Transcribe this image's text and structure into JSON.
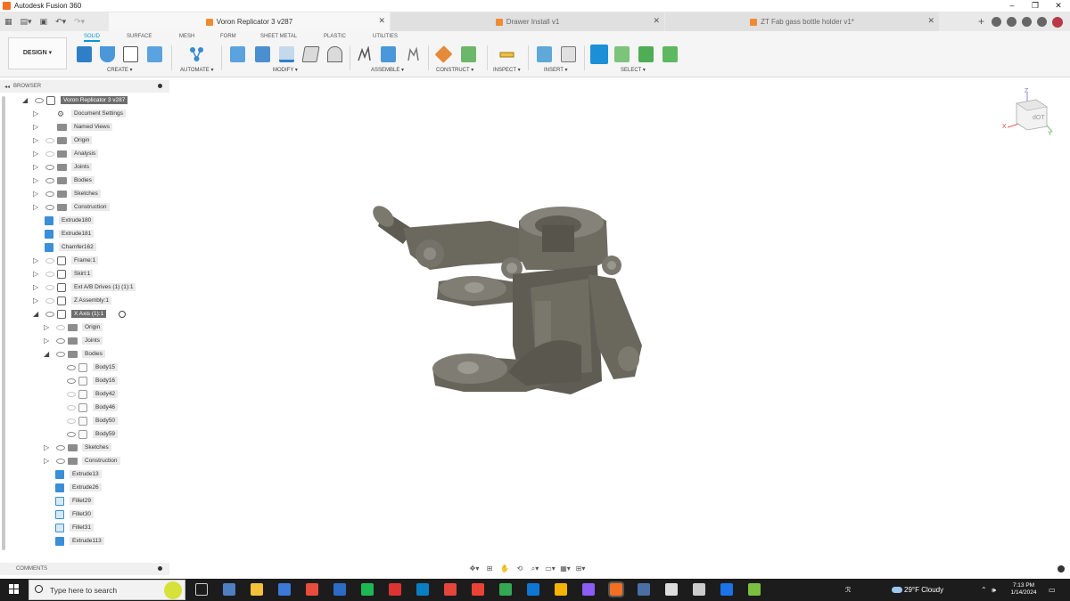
{
  "window": {
    "title": "Autodesk Fusion 360",
    "controls": [
      "–",
      "❐",
      "✕"
    ]
  },
  "tabs": [
    {
      "label": "Voron Replicator 3 v287",
      "active": true
    },
    {
      "label": "Drawer Install v1",
      "active": false
    },
    {
      "label": "ZT Fab gass bottle holder v1*",
      "active": false
    }
  ],
  "workspace": {
    "label": "DESIGN ▾"
  },
  "ribbon": {
    "tabs": [
      "SOLID",
      "SURFACE",
      "MESH",
      "FORM",
      "SHEET METAL",
      "PLASTIC",
      "UTILITIES"
    ],
    "active_tab": "SOLID",
    "groups": [
      "CREATE ▾",
      "AUTOMATE ▾",
      "MODIFY ▾",
      "ASSEMBLE ▾",
      "CONSTRUCT ▾",
      "INSPECT ▾",
      "INSERT ▾",
      "SELECT ▾"
    ]
  },
  "browser": {
    "title": "BROWSER",
    "items": [
      {
        "label": "Voron Replicator 3 v287",
        "indent": 0,
        "expanded": true,
        "icon": "component",
        "eye": true,
        "selected": true
      },
      {
        "label": "Document Settings",
        "indent": 1,
        "arrow": true,
        "icon": "gear"
      },
      {
        "label": "Named Views",
        "indent": 1,
        "arrow": true,
        "icon": "folder"
      },
      {
        "label": "Origin",
        "indent": 1,
        "arrow": true,
        "icon": "folder",
        "eye": "dim"
      },
      {
        "label": "Analysis",
        "indent": 1,
        "arrow": true,
        "icon": "folder",
        "eye": "dim"
      },
      {
        "label": "Joints",
        "indent": 1,
        "arrow": true,
        "icon": "folder",
        "eye": true
      },
      {
        "label": "Bodies",
        "indent": 1,
        "arrow": true,
        "icon": "folder",
        "eye": true
      },
      {
        "label": "Sketches",
        "indent": 1,
        "arrow": true,
        "icon": "folder",
        "eye": true
      },
      {
        "label": "Construction",
        "indent": 1,
        "arrow": true,
        "icon": "folder",
        "eye": true
      },
      {
        "label": "Extrude180",
        "indent": 1,
        "icon": "feature"
      },
      {
        "label": "Extrude181",
        "indent": 1,
        "icon": "feature"
      },
      {
        "label": "Chamfer162",
        "indent": 1,
        "icon": "feature"
      },
      {
        "label": "Frame:1",
        "indent": 1,
        "arrow": true,
        "icon": "component",
        "eye": "dim"
      },
      {
        "label": "Skirt:1",
        "indent": 1,
        "arrow": true,
        "icon": "component",
        "eye": "dim"
      },
      {
        "label": "Ext A/B Drives (1) (1):1",
        "indent": 1,
        "arrow": true,
        "icon": "component",
        "eye": "dim"
      },
      {
        "label": "Z Assembly:1",
        "indent": 1,
        "arrow": true,
        "icon": "component",
        "eye": "dim"
      },
      {
        "label": "X Axis (1):1",
        "indent": 1,
        "expanded": true,
        "icon": "component",
        "eye": true,
        "selected": true,
        "target": true
      },
      {
        "label": "Origin",
        "indent": 2,
        "arrow": true,
        "icon": "folder",
        "eye": "dim"
      },
      {
        "label": "Joints",
        "indent": 2,
        "arrow": true,
        "icon": "folder",
        "eye": true
      },
      {
        "label": "Bodies",
        "indent": 2,
        "expanded": true,
        "icon": "folder",
        "eye": true
      },
      {
        "label": "Body15",
        "indent": 3,
        "icon": "body",
        "eye": true
      },
      {
        "label": "Body16",
        "indent": 3,
        "icon": "body",
        "eye": true
      },
      {
        "label": "Body42",
        "indent": 3,
        "icon": "body",
        "eye": "dim"
      },
      {
        "label": "Body46",
        "indent": 3,
        "icon": "body",
        "eye": "dim"
      },
      {
        "label": "Body50",
        "indent": 3,
        "icon": "body",
        "eye": "dim"
      },
      {
        "label": "Body59",
        "indent": 3,
        "icon": "body",
        "eye": true
      },
      {
        "label": "Sketches",
        "indent": 2,
        "arrow": true,
        "icon": "folder",
        "eye": true
      },
      {
        "label": "Construction",
        "indent": 2,
        "arrow": true,
        "icon": "folder",
        "eye": true
      },
      {
        "label": "Extrude13",
        "indent": 2,
        "icon": "feature"
      },
      {
        "label": "Extrude26",
        "indent": 2,
        "icon": "feature"
      },
      {
        "label": "Fillet29",
        "indent": 2,
        "icon": "fillet"
      },
      {
        "label": "Fillet30",
        "indent": 2,
        "icon": "fillet"
      },
      {
        "label": "Fillet31",
        "indent": 2,
        "icon": "fillet"
      },
      {
        "label": "Extrude113",
        "indent": 2,
        "icon": "feature"
      }
    ]
  },
  "viewcube": {
    "face": "dOT",
    "axes": {
      "x": "X",
      "y": "Y",
      "z": "Z"
    }
  },
  "comments": {
    "label": "COMMENTS"
  },
  "taskbar": {
    "search_placeholder": "Type here to search",
    "weather": "29°F  Cloudy",
    "time": "7:13 PM",
    "date": "1/14/2024"
  },
  "colors": {
    "accent": "#0696d7",
    "model": "#6b685e",
    "taskbar": "#1c1c1c"
  }
}
